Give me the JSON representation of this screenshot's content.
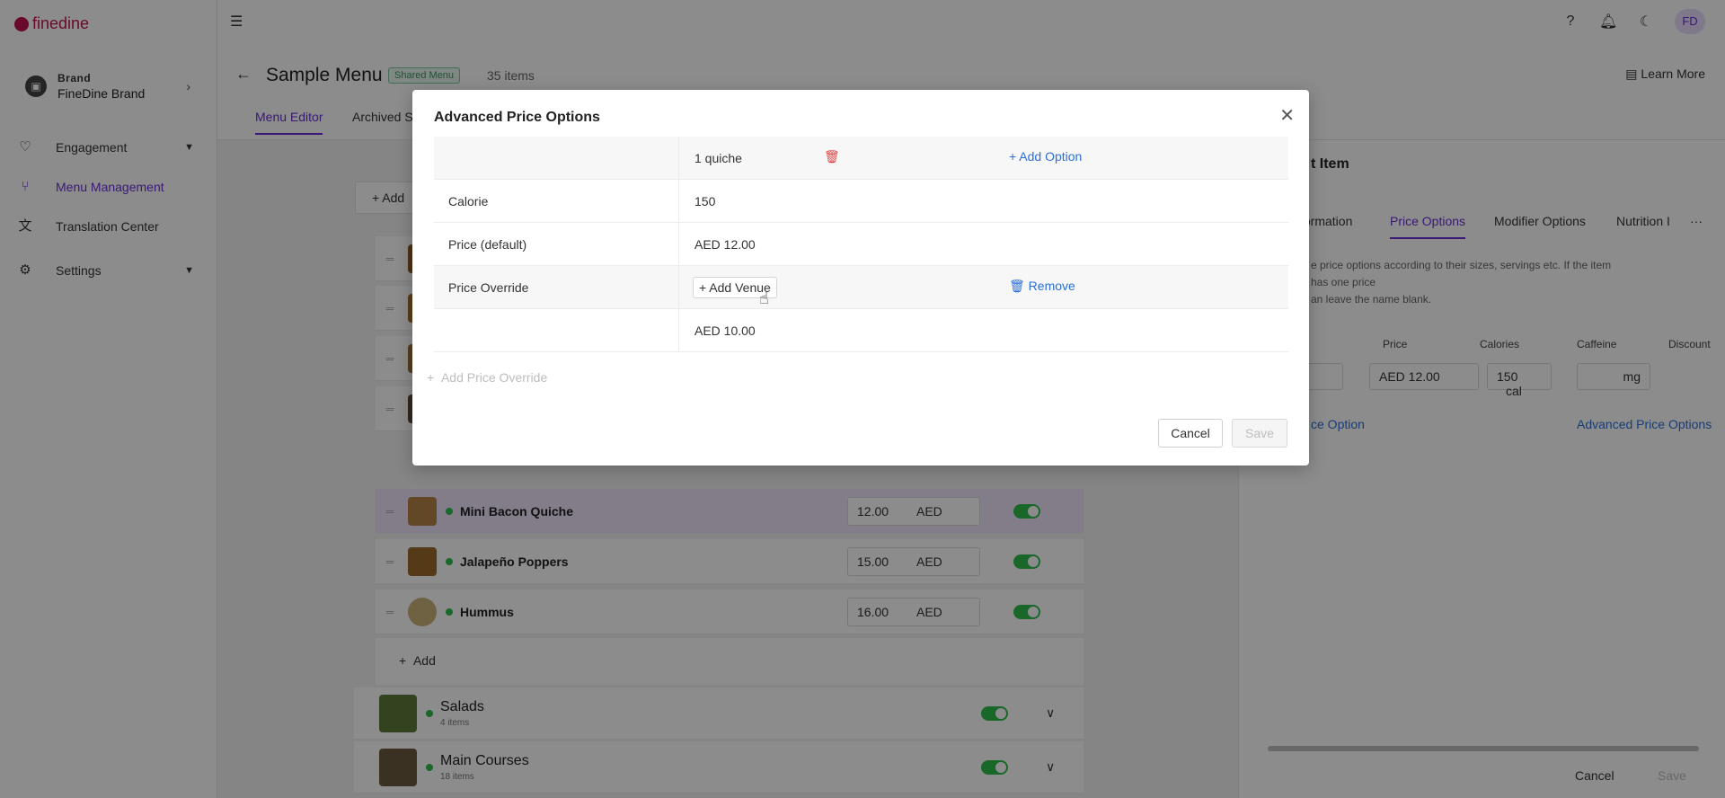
{
  "app": {
    "logo_text": "finedine"
  },
  "sidebar": {
    "brand_label": "Brand",
    "brand_name": "FineDine Brand",
    "items": [
      {
        "label": "Engagement"
      },
      {
        "label": "Menu Management"
      },
      {
        "label": "Translation Center"
      },
      {
        "label": "Settings"
      }
    ]
  },
  "header": {
    "avatar": "FD",
    "page_title": "Sample Menu",
    "badge": "Shared Menu",
    "items_count": "35 items",
    "learn_more": "Learn More",
    "tabs": [
      {
        "label": "Menu Editor"
      },
      {
        "label": "Archived S"
      }
    ]
  },
  "menu": {
    "add_label": "Add",
    "items": [
      {
        "name": "Mini Bacon Quiche",
        "price": "12.00",
        "currency": "AED"
      },
      {
        "name": "Jalapeño Poppers",
        "price": "15.00",
        "currency": "AED"
      },
      {
        "name": "Hummus",
        "price": "16.00",
        "currency": "AED"
      }
    ],
    "add_row_label": "Add",
    "categories": [
      {
        "name": "Salads",
        "count": "4 items"
      },
      {
        "name": "Main Courses",
        "count": "18 items"
      }
    ]
  },
  "right_panel": {
    "title": "t Item",
    "tabs": [
      {
        "label": "formation"
      },
      {
        "label": "Price Options"
      },
      {
        "label": "Modifier Options"
      },
      {
        "label": "Nutrition I"
      }
    ],
    "help_line1": "e price options according to their sizes, servings etc. If the item has one price",
    "help_line2": "an leave the name blank.",
    "columns": {
      "price": "Price",
      "calories": "Calories",
      "caffeine": "Caffeine",
      "discount": "Discount"
    },
    "values": {
      "price": "AED 12.00",
      "calories": "150",
      "calories_unit": "cal",
      "caffeine_unit": "mg"
    },
    "link_price_option": "ce Option",
    "link_advanced": "Advanced Price Options",
    "cancel": "Cancel",
    "save": "Save"
  },
  "modal": {
    "title": "Advanced Price Options",
    "option_name": "1 quiche",
    "add_option": "Add Option",
    "rows": [
      {
        "label": "Calorie",
        "value": "150"
      },
      {
        "label": "Price (default)",
        "value": "AED 12.00"
      },
      {
        "label": "Price Override",
        "value": ""
      }
    ],
    "add_venue": "+ Add Venue",
    "remove": "Remove",
    "override_price": "AED 10.00",
    "add_price_override": "Add Price Override",
    "cancel": "Cancel",
    "save": "Save"
  },
  "colors": {
    "accent": "#6b2ed8",
    "brand": "#c0124f",
    "link": "#2c6fd6",
    "success": "#2ebd4d",
    "danger": "#e04343"
  }
}
